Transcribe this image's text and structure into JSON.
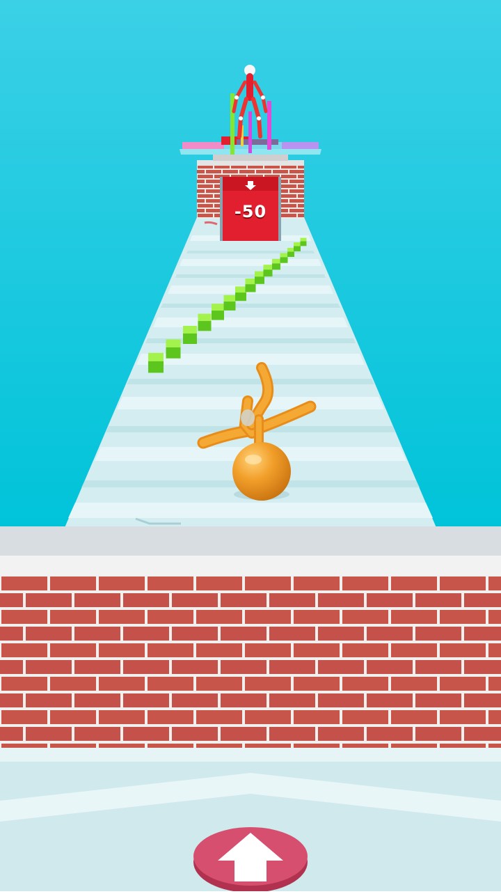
{
  "game": {
    "gate_value": "-50",
    "gate_arrow_icon": "down-arrow-icon",
    "action_button_icon": "up-arrow-icon"
  },
  "colors": {
    "sky": "#14c6df",
    "track": "#d6eef0",
    "brick": "#c8554a",
    "mortar": "#f4f4f4",
    "gate": "#e21f2e",
    "cube": "#86e62f",
    "player": "#f2a02b",
    "button": "#d64f6e"
  }
}
